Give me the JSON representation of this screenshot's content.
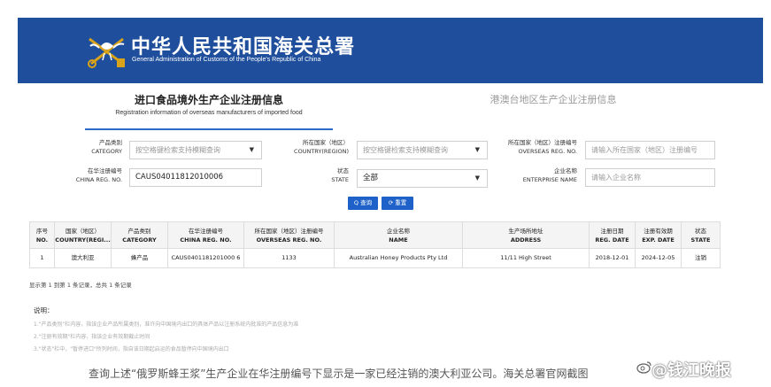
{
  "header": {
    "title_cn": "中华人民共和国海关总署",
    "title_en": "General Administration of Customs of the People's Republic of China"
  },
  "tabs": [
    {
      "label_cn": "进口食品境外生产企业注册信息",
      "label_en": "Registration information of overseas manufacturers of imported food"
    },
    {
      "label_cn": "港澳台地区生产企业注册信息"
    }
  ],
  "form": {
    "category": {
      "label_cn": "产品类别",
      "label_en": "CATEGORY",
      "placeholder": "按空格键检索支持模糊查询"
    },
    "country": {
      "label_cn": "所在国家（地区）",
      "label_en": "COUNTRY(REGION)",
      "placeholder": "按空格键检索支持模糊查询"
    },
    "overseas_reg": {
      "label_cn": "所在国家（地区）注册编号",
      "label_en": "OVERSEAS REG. NO.",
      "placeholder": "请输入所在国家（地区）注册编号"
    },
    "china_reg": {
      "label_cn": "在华注册编号",
      "label_en": "CHINA REG. NO.",
      "value": "CAUS04011812010006"
    },
    "state": {
      "label_cn": "状态",
      "label_en": "STATE",
      "value": "全部"
    },
    "enterprise": {
      "label_cn": "企业名称",
      "label_en": "ENTERPRISE NAME",
      "placeholder": "请输入企业名称"
    },
    "search_label": "Q 查询",
    "reset_label": "⟳ 重置"
  },
  "table": {
    "columns": [
      {
        "cn": "序号",
        "en": "NO."
      },
      {
        "cn": "国家（地区）",
        "en": "COUNTRY(REGI..."
      },
      {
        "cn": "产品类别",
        "en": "CATEGORY"
      },
      {
        "cn": "在华注册编号",
        "en": "CHINA REG. NO."
      },
      {
        "cn": "所在国家（地区）注册编号",
        "en": "OVERSEAS REG. NO."
      },
      {
        "cn": "企业名称",
        "en": "NAME"
      },
      {
        "cn": "生产场所地址",
        "en": "ADDRESS"
      },
      {
        "cn": "注册日期",
        "en": "REG. DATE"
      },
      {
        "cn": "注册有效期",
        "en": "EXP. DATE"
      },
      {
        "cn": "状态",
        "en": "STATE"
      }
    ],
    "rows": [
      [
        "1",
        "澳大利亚",
        "蜂产品",
        "CAUS0401181201000 6",
        "1133",
        "Australian Honey Products Pty Ltd",
        "11/11 High Street",
        "2018-12-01",
        "2024-12-05",
        "注销"
      ]
    ]
  },
  "summary": "显示第 1 到第 1 条记录，总共 1 条记录",
  "notes": {
    "title": "说明：",
    "items": [
      "1.\"产品类别\"栏内容，指该企业产品所属类别，准许向中国境内出口的具体产品以注册系统内批准的产品信息为准",
      "2.\"注册有效期\"栏内容，指该企业有效期截止时间",
      "3.\"状态\"栏中，\"暂停进口\"所列时间，指自该日期起启运的食品暂停向中国境内出口"
    ]
  },
  "caption": "查询上述“俄罗斯蜂王浆”生产企业在华注册编号下显示是一家已经注销的澳大利亚公司。海关总署官网截图",
  "watermark": "@钱江晚报",
  "colors": {
    "banner": "#1f4f9c",
    "button": "#1e62c9",
    "tab_underline": "#2d6bc9"
  }
}
